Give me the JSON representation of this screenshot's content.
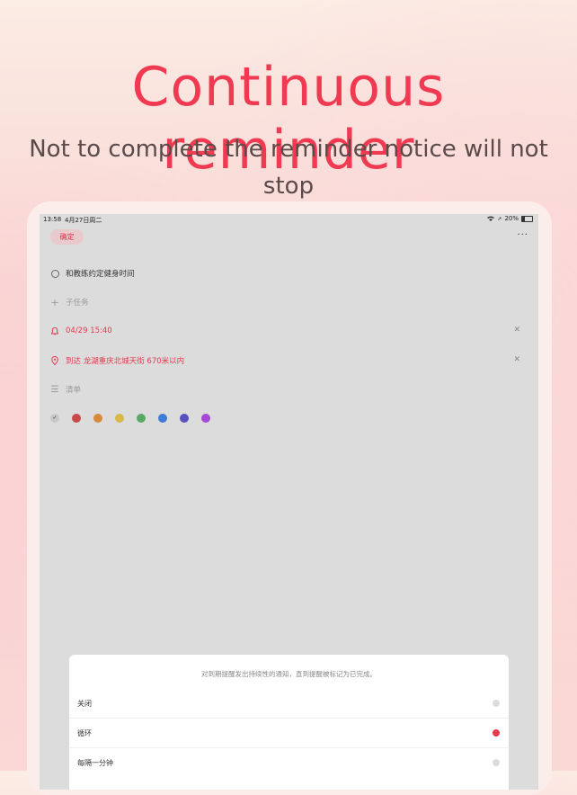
{
  "promo": {
    "headline": "Continuous reminder",
    "subline": "Not to complete the reminder notice will not stop"
  },
  "status_bar": {
    "time": "13:58",
    "date": "4月27日周二",
    "battery": "20%"
  },
  "toolbar": {
    "confirm_label": "确定",
    "more_label": "···"
  },
  "task": {
    "title": "和教练约定健身时间",
    "subtask_placeholder": "子任务",
    "reminder_time": "04/29 15:40",
    "location": "到达 龙湖重庆北城天街 670米以内",
    "list_label": "清单"
  },
  "colors": [
    "#c9494b",
    "#d68a3c",
    "#d8b84a",
    "#5aaa64",
    "#3d7bd6",
    "#5a4fbf",
    "#a349d4"
  ],
  "sheet": {
    "description": "对到期提醒发出持续性的通知，直到提醒被标记为已完成。",
    "options": [
      {
        "label": "关闭",
        "selected": false
      },
      {
        "label": "循环",
        "selected": true
      },
      {
        "label": "每隔一分钟",
        "selected": false
      }
    ]
  },
  "accent_color": "#e23b4e"
}
